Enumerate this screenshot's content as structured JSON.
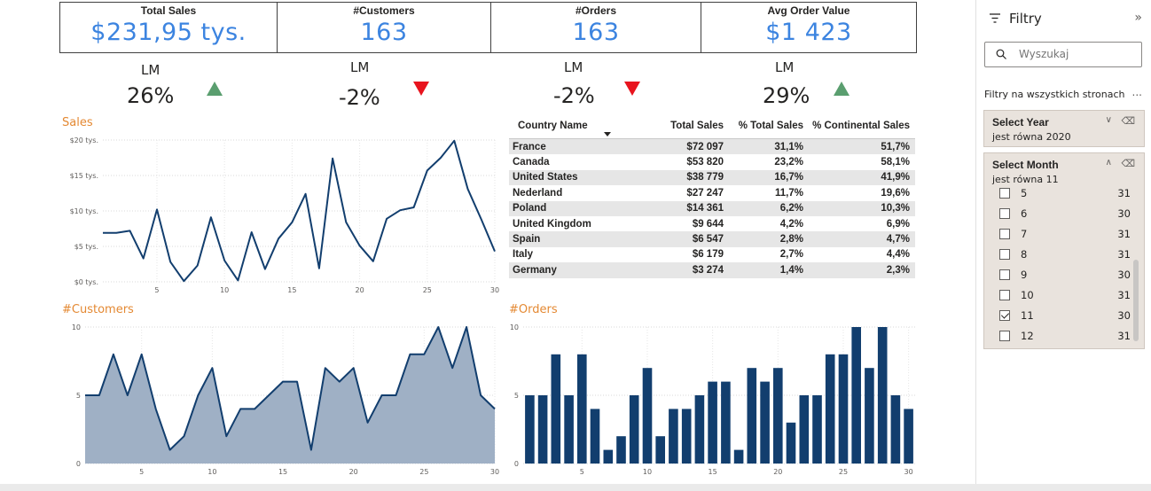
{
  "kpis": [
    {
      "title": "Total Sales",
      "value": "$231,95 tys.",
      "lm_label": "LM",
      "lm_value": "26%",
      "trend": "up"
    },
    {
      "title": "#Customers",
      "value": "163",
      "lm_label": "LM",
      "lm_value": "-2%",
      "trend": "down"
    },
    {
      "title": "#Orders",
      "value": "163",
      "lm_label": "LM",
      "lm_value": "-2%",
      "trend": "down"
    },
    {
      "title": "Avg Order Value",
      "value": "$1 423",
      "lm_label": "LM",
      "lm_value": "29%",
      "trend": "up"
    }
  ],
  "colors": {
    "accent": "#3c84e0",
    "navy": "#123e6e",
    "area_fill": "#9fb0c5",
    "title_orange": "#e48933",
    "up": "#5a9e6f",
    "down": "#e8141e"
  },
  "table": {
    "headers": [
      "Country Name",
      "Total Sales",
      "% Total Sales",
      "% Continental Sales"
    ],
    "rows": [
      [
        "France",
        "$72 097",
        "31,1%",
        "51,7%"
      ],
      [
        "Canada",
        "$53 820",
        "23,2%",
        "58,1%"
      ],
      [
        "United States",
        "$38 779",
        "16,7%",
        "41,9%"
      ],
      [
        "Nederland",
        "$27 247",
        "11,7%",
        "19,6%"
      ],
      [
        "Poland",
        "$14 361",
        "6,2%",
        "10,3%"
      ],
      [
        "United Kingdom",
        "$9 644",
        "4,2%",
        "6,9%"
      ],
      [
        "Spain",
        "$6 547",
        "2,8%",
        "4,7%"
      ],
      [
        "Italy",
        "$6 179",
        "2,7%",
        "4,4%"
      ],
      [
        "Germany",
        "$3 274",
        "1,4%",
        "2,3%"
      ]
    ]
  },
  "chart_data": [
    {
      "type": "line",
      "title": "Sales",
      "x": [
        1,
        2,
        3,
        4,
        5,
        6,
        7,
        8,
        9,
        10,
        11,
        12,
        13,
        14,
        15,
        16,
        17,
        18,
        19,
        20,
        21,
        22,
        23,
        24,
        25,
        26,
        27,
        28,
        29,
        30
      ],
      "series": [
        {
          "values": [
            6.9,
            6.9,
            7.2,
            3.3,
            10.2,
            2.8,
            0.1,
            2.3,
            9.1,
            3.0,
            0.2,
            7.0,
            1.8,
            6.1,
            8.4,
            12.4,
            1.9,
            17.4,
            8.4,
            5.1,
            2.9,
            8.9,
            10.1,
            10.5,
            15.7,
            17.5,
            19.9,
            13.1,
            8.8,
            4.3
          ]
        }
      ],
      "y_ticks": [
        "$0 tys.",
        "$5 tys.",
        "$10 tys.",
        "$15 tys.",
        "$20 tys."
      ],
      "x_ticks": [
        "5",
        "10",
        "15",
        "20",
        "25",
        "30"
      ],
      "ylim": [
        0,
        20
      ],
      "grid": true
    },
    {
      "type": "area",
      "title": "#Customers",
      "x": [
        1,
        2,
        3,
        4,
        5,
        6,
        7,
        8,
        9,
        10,
        11,
        12,
        13,
        14,
        15,
        16,
        17,
        18,
        19,
        20,
        21,
        22,
        23,
        24,
        25,
        26,
        27,
        28,
        29,
        30
      ],
      "series": [
        {
          "values": [
            5,
            5,
            8,
            5,
            8,
            4,
            1,
            2,
            5,
            7,
            2,
            4,
            4,
            5,
            6,
            6,
            1,
            7,
            6,
            7,
            3,
            5,
            5,
            8,
            8,
            10,
            7,
            10,
            5,
            4
          ]
        }
      ],
      "y_ticks": [
        "0",
        "5",
        "10"
      ],
      "x_ticks": [
        "5",
        "10",
        "15",
        "20",
        "25",
        "30"
      ],
      "ylim": [
        0,
        10
      ],
      "grid": true
    },
    {
      "type": "bar",
      "title": "#Orders",
      "categories": [
        1,
        2,
        3,
        4,
        5,
        6,
        7,
        8,
        9,
        10,
        11,
        12,
        13,
        14,
        15,
        16,
        17,
        18,
        19,
        20,
        21,
        22,
        23,
        24,
        25,
        26,
        27,
        28,
        29,
        30
      ],
      "values": [
        5,
        5,
        8,
        5,
        8,
        4,
        1,
        2,
        5,
        7,
        2,
        4,
        4,
        5,
        6,
        6,
        1,
        7,
        6,
        7,
        3,
        5,
        5,
        8,
        8,
        10,
        7,
        10,
        5,
        4
      ],
      "y_ticks": [
        "0",
        "5",
        "10"
      ],
      "x_ticks": [
        "5",
        "10",
        "15",
        "20",
        "25",
        "30"
      ],
      "ylim": [
        0,
        10
      ],
      "grid": true
    }
  ],
  "filters": {
    "title": "Filtry",
    "collapse_icon": "chevron-double-right-icon",
    "search_placeholder": "Wyszukaj",
    "section_label": "Filtry na wszystkich stronach",
    "more_label": "...",
    "year_card": {
      "title": "Select Year",
      "subtitle": "jest równa 2020"
    },
    "month_card": {
      "title": "Select Month",
      "subtitle": "jest równa 11",
      "items": [
        {
          "label": "5",
          "count": "31",
          "checked": false
        },
        {
          "label": "6",
          "count": "30",
          "checked": false
        },
        {
          "label": "7",
          "count": "31",
          "checked": false
        },
        {
          "label": "8",
          "count": "31",
          "checked": false
        },
        {
          "label": "9",
          "count": "30",
          "checked": false
        },
        {
          "label": "10",
          "count": "31",
          "checked": false
        },
        {
          "label": "11",
          "count": "30",
          "checked": true
        },
        {
          "label": "12",
          "count": "31",
          "checked": false
        }
      ]
    }
  }
}
